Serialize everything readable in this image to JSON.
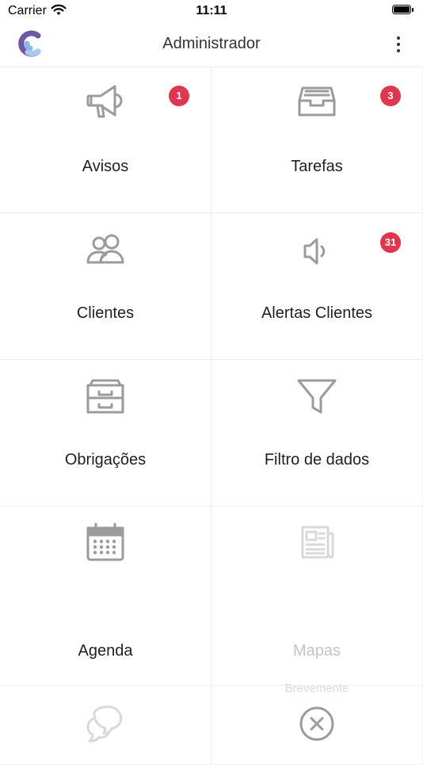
{
  "status_bar": {
    "carrier": "Carrier",
    "time": "11:11"
  },
  "header": {
    "title": "Administrador"
  },
  "colors": {
    "badge": "#e0364e",
    "icon": "#9b9b9b",
    "disabled": "#d9d9d9"
  },
  "tiles": [
    {
      "label": "Avisos",
      "icon": "megaphone-icon",
      "badge": "1"
    },
    {
      "label": "Tarefas",
      "icon": "inbox-tray-icon",
      "badge": "3"
    },
    {
      "label": "Clientes",
      "icon": "users-icon"
    },
    {
      "label": "Alertas Clientes",
      "icon": "speaker-icon",
      "badge": "31"
    },
    {
      "label": "Obrigações",
      "icon": "archive-icon"
    },
    {
      "label": "Filtro de dados",
      "icon": "funnel-icon"
    },
    {
      "label": "Agenda",
      "icon": "calendar-icon"
    },
    {
      "label": "Mapas",
      "icon": "newspaper-icon",
      "subtitle": "Brevemente",
      "disabled": true
    },
    {
      "icon": "chat-bubbles-icon",
      "disabled": true
    },
    {
      "icon": "close-circle-icon"
    }
  ]
}
